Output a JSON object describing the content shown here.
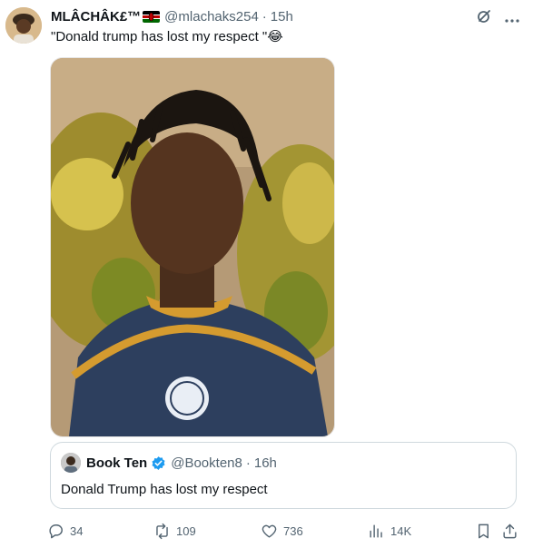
{
  "tweet": {
    "author_name": "MLÂCHÂK£™",
    "handle": "@mlachaks254",
    "separator": "·",
    "time": "15h",
    "text": "\"Donald trump has lost my respect \"😂"
  },
  "quoted": {
    "author_name": "Book Ten",
    "handle": "@Bookten8",
    "separator": "·",
    "time": "16h",
    "text": "Donald Trump has lost my respect"
  },
  "actions": {
    "replies": "34",
    "reposts": "109",
    "likes": "736",
    "views": "14K"
  },
  "colors": {
    "verified": "#1d9bf0",
    "secondary_text": "#536471",
    "border": "#cfd9de"
  }
}
